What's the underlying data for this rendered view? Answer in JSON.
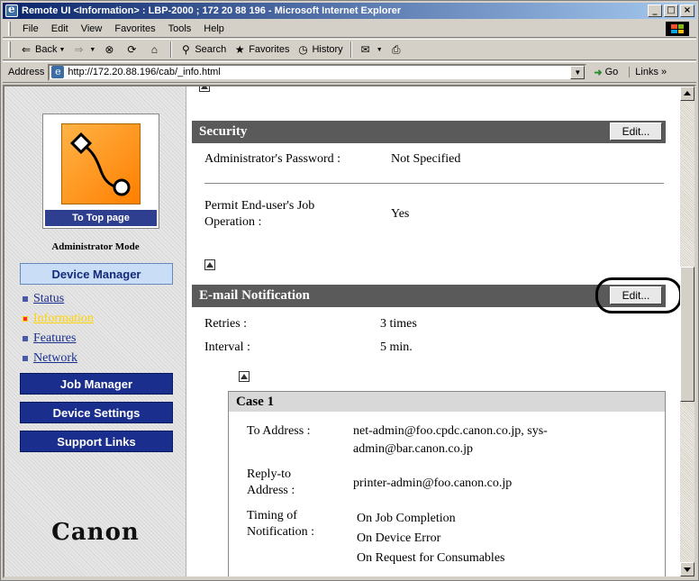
{
  "window": {
    "title": "Remote UI <Information> : LBP-2000 ; 172 20 88 196 - Microsoft Internet Explorer",
    "min": "_",
    "max": "□",
    "close": "×"
  },
  "menu": [
    "File",
    "Edit",
    "View",
    "Favorites",
    "Tools",
    "Help"
  ],
  "toolbar": {
    "back": "Back",
    "search": "Search",
    "favorites": "Favorites",
    "history": "History"
  },
  "address": {
    "label": "Address",
    "url": "http://172.20.88.196/cab/_info.html",
    "go": "Go",
    "links": "Links »"
  },
  "sidebar": {
    "top_page": "To Top page",
    "mode": "Administrator Mode",
    "device_manager": "Device Manager",
    "links": [
      {
        "label": "Status",
        "active": false
      },
      {
        "label": "Information",
        "active": true
      },
      {
        "label": "Features",
        "active": false
      },
      {
        "label": "Network",
        "active": false
      }
    ],
    "job_manager": "Job Manager",
    "device_settings": "Device Settings",
    "support_links": "Support Links",
    "brand": "Canon"
  },
  "security": {
    "title": "Security",
    "edit": "Edit...",
    "admin_pw_label": "Administrator's Password :",
    "admin_pw_value": "Not Specified",
    "permit_label_1": "Permit End-user's Job",
    "permit_label_2": "Operation :",
    "permit_value": "Yes"
  },
  "email": {
    "title": "E-mail Notification",
    "edit": "Edit...",
    "retries_label": "Retries :",
    "retries_value": "3 times",
    "interval_label": "Interval :",
    "interval_value": "5 min."
  },
  "case1": {
    "title": "Case 1",
    "to_label": "To Address :",
    "to_value_1": "net-admin@foo.cpdc.canon.co.jp, sys-",
    "to_value_2": "admin@bar.canon.co.jp",
    "reply_label_1": "Reply-to",
    "reply_label_2": "Address :",
    "reply_value": "printer-admin@foo.canon.co.jp",
    "timing_label_1": "Timing of",
    "timing_label_2": "Notification :",
    "timing_1": "On Job Completion",
    "timing_2": "On Device Error",
    "timing_3": "On Request for Consumables"
  }
}
